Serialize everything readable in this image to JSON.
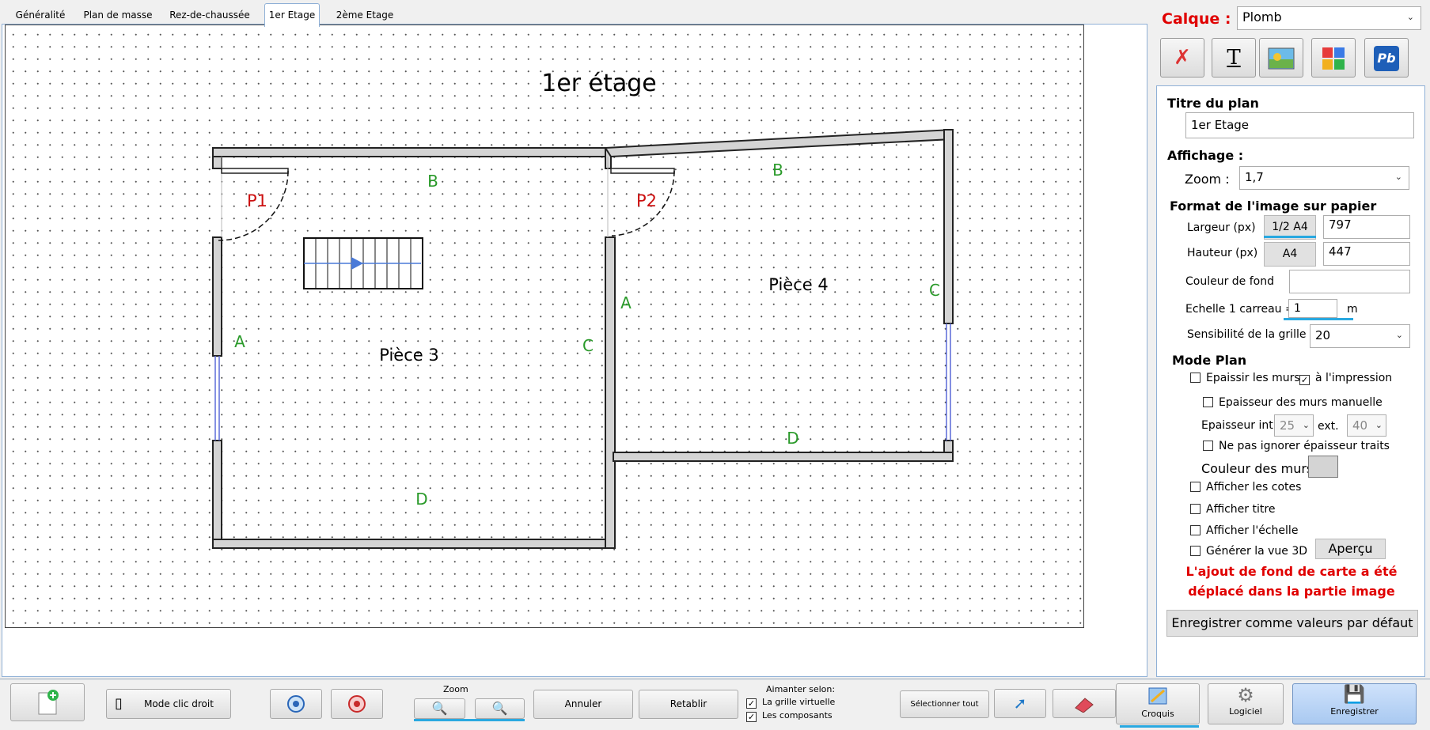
{
  "tabs": [
    "Généralité",
    "Plan de masse",
    "Rez-de-chaussée",
    "1er Etage",
    "2ème Etage"
  ],
  "active_tab": "1er Etage",
  "plan": {
    "title": "1er étage",
    "rooms": [
      "Pièce  3",
      "Pièce  4"
    ],
    "doors": [
      "P1",
      "P2"
    ],
    "wall_labels": {
      "b": "B",
      "a": "A",
      "c": "C",
      "d": "D"
    }
  },
  "panel": {
    "calque_label": "Calque :",
    "calque_value": "Plomb",
    "tools": [
      "scissors-icon",
      "text-tool-icon",
      "image-icon",
      "puzzle-icon",
      "pb-logo-icon"
    ],
    "pb_text": "Pb",
    "text_tool_glyph": "T",
    "titre_label": "Titre du plan",
    "titre_value": "1er Etage",
    "affichage_label": "Affichage :",
    "zoom_label": "Zoom :",
    "zoom_value": "1,7",
    "format_label": "Format de l'image sur papier",
    "largeur_label": "Largeur (px)",
    "largeur_btn": "1/2 A4",
    "largeur_value": "797",
    "hauteur_label": "Hauteur (px)",
    "hauteur_btn": "A4",
    "hauteur_value": "447",
    "couleur_fond_label": "Couleur de fond",
    "echelle_label": "Echelle 1 carreau =",
    "echelle_value": "1",
    "echelle_unit": "m",
    "sensibilite_label": "Sensibilité de la grille",
    "sensibilite_value": "20",
    "mode_plan_label": "Mode Plan",
    "epaissir_label": "Epaissir les murs",
    "epaissir_checked": false,
    "impression_label": "à l'impression",
    "impression_checked": true,
    "epaisseur_manuelle_label": "Epaisseur des murs manuelle",
    "epaisseur_int_label": "Epaisseur int.",
    "epaisseur_int_value": "25",
    "epaisseur_ext_label": "ext.",
    "epaisseur_ext_value": "40",
    "ne_pas_ignorer_label": "Ne pas ignorer épaisseur traits",
    "couleur_murs_label": "Couleur des murs",
    "couleur_murs": "#d4d4d4",
    "afficher_cotes_label": "Afficher les cotes",
    "afficher_titre_label": "Afficher titre",
    "afficher_echelle_label": "Afficher l'échelle",
    "generer_3d_label": "Générer la vue 3D",
    "apercu_label": "Aperçu",
    "warning_line1": "L'ajout de fond de carte a été",
    "warning_line2": "déplacé dans la partie image",
    "enregistrer_defaut_label": "Enregistrer comme valeurs par défaut"
  },
  "bottom": {
    "mode_clic_droit": "Mode clic droit",
    "zoom_label": "Zoom",
    "annuler": "Annuler",
    "retablir": "Retablir",
    "aimanter_label": "Aimanter selon:",
    "grille_virtuelle": "La grille virtuelle",
    "composants": "Les composants",
    "selectionner_tout": "Sélectionner tout",
    "croquis": "Croquis",
    "logiciel": "Logiciel",
    "enregistrer": "Enregistrer",
    "check_glyph": "✓"
  },
  "colors": {
    "accent_red": "#e00000",
    "accent_blue": "#29a8e0",
    "wall_label_green": "#2a9a2a",
    "door_label_red": "#cc1010",
    "wall_fill": "#d4d4d4"
  }
}
